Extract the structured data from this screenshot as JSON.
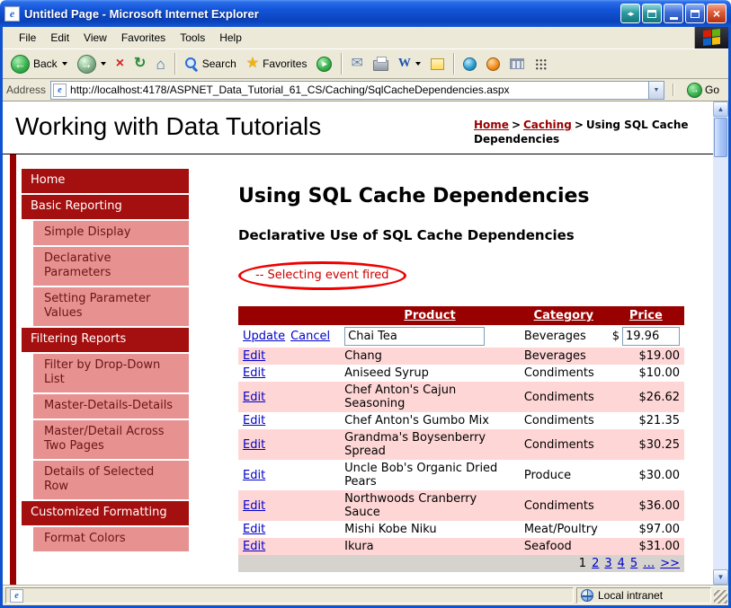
{
  "colors": {
    "maroon": "#990000",
    "sidebar_section": "#a40f0f",
    "sidebar_item": "#e79191",
    "sidebar_item_text": "#6b1616",
    "row_pink": "#ffd6d6",
    "pager_gray": "#d6d3ce",
    "link_blue": "#0000cc",
    "annotation_red": "#ee0000",
    "message_red": "#cc0000"
  },
  "icons": {
    "ie_logo": "e",
    "back_arrow": "←",
    "forward_arrow": "→",
    "stop": "×",
    "refresh": "↻",
    "home": "⌂",
    "favorites_star": "★",
    "media_play": "▸",
    "mail": "✉",
    "word": "W",
    "go_arrow": "→",
    "dropdown": "▼",
    "scroll_up": "▲",
    "scroll_down": "▼",
    "vm_arrows": "◂▸",
    "close": "×"
  },
  "titlebar": {
    "title": "Untitled Page - Microsoft Internet Explorer"
  },
  "menubar": {
    "items": [
      "File",
      "Edit",
      "View",
      "Favorites",
      "Tools",
      "Help"
    ]
  },
  "toolbar": {
    "back": "Back",
    "search": "Search",
    "favorites": "Favorites"
  },
  "addressbar": {
    "label": "Address",
    "url": "http://localhost:4178/ASPNET_Data_Tutorial_61_CS/Caching/SqlCacheDependencies.aspx",
    "go": "Go"
  },
  "page": {
    "site_title": "Working with Data Tutorials",
    "breadcrumb": {
      "home": "Home",
      "caching": "Caching",
      "separator": ">",
      "current": "Using SQL Cache Dependencies"
    },
    "sidebar": {
      "items": [
        {
          "label": "Home",
          "type": "section"
        },
        {
          "label": "Basic Reporting",
          "type": "section"
        },
        {
          "label": "Simple Display",
          "type": "item"
        },
        {
          "label": "Declarative Parameters",
          "type": "item"
        },
        {
          "label": "Setting Parameter Values",
          "type": "item"
        },
        {
          "label": "Filtering Reports",
          "type": "section"
        },
        {
          "label": "Filter by Drop-Down List",
          "type": "item"
        },
        {
          "label": "Master-Details-Details",
          "type": "item"
        },
        {
          "label": "Master/Detail Across Two Pages",
          "type": "item"
        },
        {
          "label": "Details of Selected Row",
          "type": "item"
        },
        {
          "label": "Customized Formatting",
          "type": "section"
        },
        {
          "label": "Format Colors",
          "type": "item"
        }
      ]
    },
    "main": {
      "heading": "Using SQL Cache Dependencies",
      "subheading": "Declarative Use of SQL Cache Dependencies",
      "event_message": "-- Selecting event fired",
      "grid": {
        "headers": {
          "product": "Product",
          "category": "Category",
          "price": "Price"
        },
        "edit_row": {
          "update": "Update",
          "cancel": "Cancel",
          "product_value": "Chai Tea",
          "category": "Beverages",
          "currency": "$",
          "price_value": "19.96"
        },
        "rows": [
          {
            "action": "Edit",
            "product": "Chang",
            "category": "Beverages",
            "price": "$19.00"
          },
          {
            "action": "Edit",
            "product": "Aniseed Syrup",
            "category": "Condiments",
            "price": "$10.00"
          },
          {
            "action": "Edit",
            "product": "Chef Anton's Cajun Seasoning",
            "category": "Condiments",
            "price": "$26.62"
          },
          {
            "action": "Edit",
            "product": "Chef Anton's Gumbo Mix",
            "category": "Condiments",
            "price": "$21.35"
          },
          {
            "action": "Edit",
            "product": "Grandma's Boysenberry Spread",
            "category": "Condiments",
            "price": "$30.25"
          },
          {
            "action": "Edit",
            "product": "Uncle Bob's Organic Dried Pears",
            "category": "Produce",
            "price": "$30.00"
          },
          {
            "action": "Edit",
            "product": "Northwoods Cranberry Sauce",
            "category": "Condiments",
            "price": "$36.00"
          },
          {
            "action": "Edit",
            "product": "Mishi Kobe Niku",
            "category": "Meat/Poultry",
            "price": "$97.00"
          },
          {
            "action": "Edit",
            "product": "Ikura",
            "category": "Seafood",
            "price": "$31.00"
          }
        ],
        "pager": {
          "current": "1",
          "pages": [
            "2",
            "3",
            "4",
            "5"
          ],
          "ellipsis": "…",
          "next": ">>"
        }
      }
    }
  },
  "statusbar": {
    "zone": "Local intranet"
  }
}
